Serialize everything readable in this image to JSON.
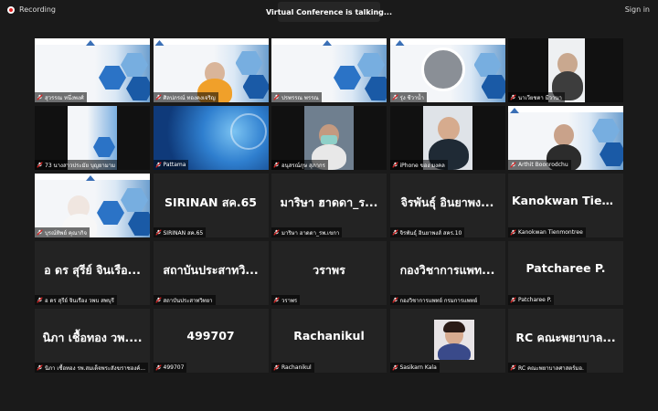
{
  "topbar": {
    "recording_label": "Recording",
    "title": "Virtual Conference is talking...",
    "signin_label": "Sign in"
  },
  "colors": {
    "background": "#1a1a1a",
    "tile": "#232323",
    "muted_mic": "#e02020",
    "brand_blue": "#2b73c6"
  },
  "participants": [
    {
      "name": "สุวรรณ หนึ่งพงศ์",
      "display": "",
      "muted": true
    },
    {
      "name": "ศิลปภรณ์ ทองคงเจริญ",
      "display": "",
      "muted": true
    },
    {
      "name": "ปรพรรณ พรรณ",
      "display": "",
      "muted": true
    },
    {
      "name": "รุ่ง ชีวาน้ำ",
      "display": "",
      "muted": true
    },
    {
      "name": "นาเวียชตา มีวานา",
      "display": "",
      "muted": true
    },
    {
      "name": "73 นางสาวประมัย บุญยามาม",
      "display": "",
      "muted": true
    },
    {
      "name": "Pattama",
      "display": "",
      "muted": true
    },
    {
      "name": "อนุสรณ์ภุษ สุภากร",
      "display": "",
      "muted": true
    },
    {
      "name": "iPhone ของ มงคล",
      "display": "",
      "muted": true
    },
    {
      "name": "Arthit Boonrodchu",
      "display": "",
      "muted": true
    },
    {
      "name": "บุรณ์ทิพย์ คุณากิจ",
      "display": "",
      "muted": true
    },
    {
      "name": "SIRINAN สค.65",
      "display": "SIRINAN สค.65",
      "muted": true
    },
    {
      "name": "มาริษา ฮาดดา_รพ.เขกา",
      "display": "มาริษา ฮาดดา_ร...",
      "muted": true
    },
    {
      "name": "จิรพันธุ์ อินยาพงส์ สคร.10",
      "display": "จิรพันธุ์ อินยาพง...",
      "muted": true
    },
    {
      "name": "Kanokwan Tienmontree",
      "display": "Kanokwan Tien...",
      "muted": true
    },
    {
      "name": "อ ดร สุรีย์ จินเรือง วพบ สพบุรี",
      "display": "อ ดร สุรีย์ จินเรือ...",
      "muted": true
    },
    {
      "name": "สถาบันประสาทวิทยา",
      "display": "สถาบันประสาทวิ...",
      "muted": true
    },
    {
      "name": "วราพร",
      "display": "วราพร",
      "muted": true
    },
    {
      "name": "กองวิชาการแพทย์ กรมการแพทย์",
      "display": "กองวิชาการแพท...",
      "muted": true
    },
    {
      "name": "Patcharee P.",
      "display": "Patcharee P.",
      "muted": true
    },
    {
      "name": "นิภา เชื้อทอง รพ.สมเด็จพระสังฆราชองค์...",
      "display": "นิภา เชื้อทอง วพ....",
      "muted": true
    },
    {
      "name": "499707",
      "display": "499707",
      "muted": true
    },
    {
      "name": "Rachanikul",
      "display": "Rachanikul",
      "muted": true
    },
    {
      "name": "Sasikarn Kala",
      "display": "",
      "muted": true
    },
    {
      "name": "RC คณะพยาบาลศาสตร์มอ.",
      "display": "RC คณะพยาบาล...",
      "muted": true
    }
  ]
}
